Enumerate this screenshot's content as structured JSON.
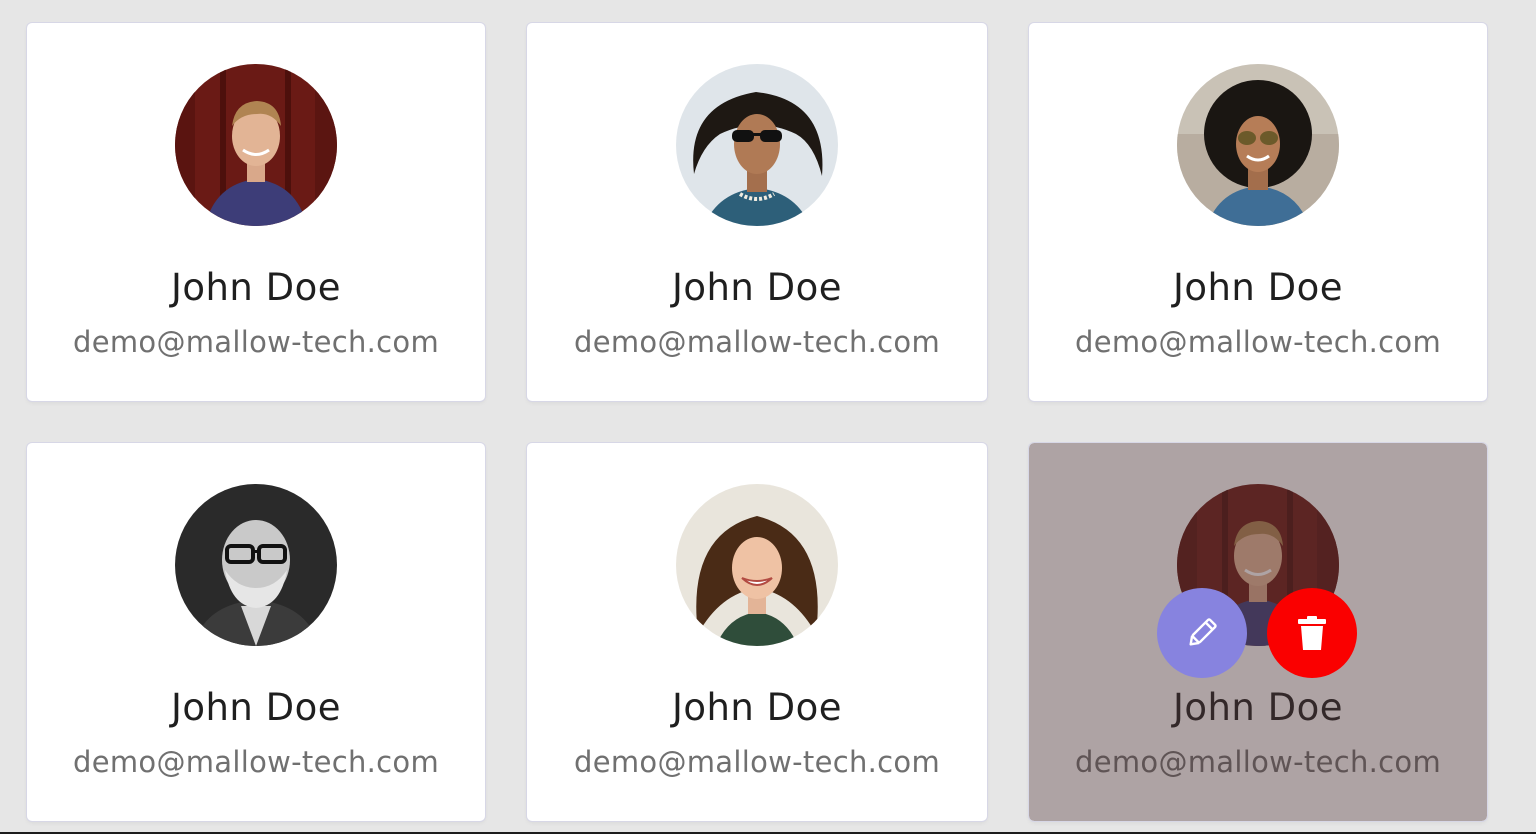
{
  "cards": [
    {
      "name": "John Doe",
      "email": "demo@mallow-tech.com"
    },
    {
      "name": "John Doe",
      "email": "demo@mallow-tech.com"
    },
    {
      "name": "John Doe",
      "email": "demo@mallow-tech.com"
    },
    {
      "name": "John Doe",
      "email": "demo@mallow-tech.com"
    },
    {
      "name": "John Doe",
      "email": "demo@mallow-tech.com"
    },
    {
      "name": "John Doe",
      "email": "demo@mallow-tech.com"
    }
  ],
  "hover_actions": {
    "edit_icon": "pencil-icon",
    "delete_icon": "trash-icon",
    "edit_color": "#8783df",
    "delete_color": "#fa0000"
  },
  "colors": {
    "background": "#e6e6e6",
    "card": "#ffffff",
    "name_text": "#1f1f1f",
    "email_text": "#707070"
  }
}
